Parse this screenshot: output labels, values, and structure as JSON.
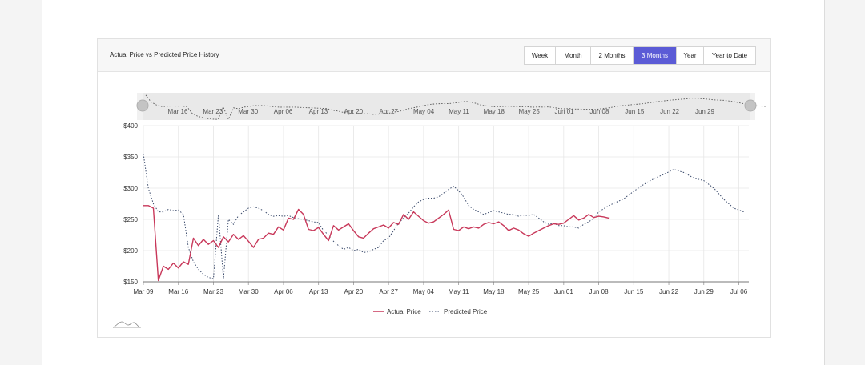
{
  "header": {
    "title": "Actual Price vs Predicted Price History",
    "ranges": [
      "Week",
      "Month",
      "2 Months",
      "3 Months",
      "Year",
      "Year to Date"
    ],
    "active_range": "3 Months"
  },
  "colors": {
    "actual": "#c8385a",
    "predicted": "#3a4a6b",
    "active_button": "#5b5bd6",
    "grid": "#e6e6e6"
  },
  "chart_data": {
    "type": "line",
    "title": "",
    "xlabel": "",
    "ylabel": "",
    "ylim": [
      150,
      400
    ],
    "y_ticks": [
      "$150",
      "$200",
      "$250",
      "$300",
      "$350",
      "$400"
    ],
    "y_tick_values": [
      150,
      200,
      250,
      300,
      350,
      400
    ],
    "x_range": [
      "2020-03-09",
      "2020-07-08"
    ],
    "x_ticks": [
      "Mar 09",
      "Mar 16",
      "Mar 23",
      "Mar 30",
      "Apr 06",
      "Apr 13",
      "Apr 20",
      "Apr 27",
      "May 04",
      "May 11",
      "May 18",
      "May 25",
      "Jun 01",
      "Jun 08",
      "Jun 15",
      "Jun 22",
      "Jun 29",
      "Jul 06"
    ],
    "x_tick_dates": [
      "2020-03-09",
      "2020-03-16",
      "2020-03-23",
      "2020-03-30",
      "2020-04-06",
      "2020-04-13",
      "2020-04-20",
      "2020-04-27",
      "2020-05-04",
      "2020-05-11",
      "2020-05-18",
      "2020-05-25",
      "2020-06-01",
      "2020-06-08",
      "2020-06-15",
      "2020-06-22",
      "2020-06-29",
      "2020-07-06"
    ],
    "navigator_ticks": [
      "Mar 16",
      "Mar 23",
      "Mar 30",
      "Apr 06",
      "Apr 13",
      "Apr 20",
      "Apr 27",
      "May 04",
      "May 11",
      "May 18",
      "May 25",
      "Jun 01",
      "Jun 08",
      "Jun 15",
      "Jun 22",
      "Jun 29"
    ],
    "grid": true,
    "legend_position": "bottom-center",
    "series": [
      {
        "name": "Actual Price",
        "style": "solid",
        "points": [
          [
            "2020-03-09",
            272
          ],
          [
            "2020-03-10",
            272
          ],
          [
            "2020-03-11",
            268
          ],
          [
            "2020-03-12",
            152
          ],
          [
            "2020-03-13",
            175
          ],
          [
            "2020-03-14",
            170
          ],
          [
            "2020-03-15",
            180
          ],
          [
            "2020-03-16",
            172
          ],
          [
            "2020-03-17",
            182
          ],
          [
            "2020-03-18",
            178
          ],
          [
            "2020-03-19",
            220
          ],
          [
            "2020-03-20",
            208
          ],
          [
            "2020-03-21",
            218
          ],
          [
            "2020-03-22",
            210
          ],
          [
            "2020-03-23",
            216
          ],
          [
            "2020-03-24",
            205
          ],
          [
            "2020-03-25",
            222
          ],
          [
            "2020-03-26",
            214
          ],
          [
            "2020-03-27",
            226
          ],
          [
            "2020-03-28",
            218
          ],
          [
            "2020-03-29",
            224
          ],
          [
            "2020-03-30",
            215
          ],
          [
            "2020-03-31",
            205
          ],
          [
            "2020-04-01",
            218
          ],
          [
            "2020-04-02",
            220
          ],
          [
            "2020-04-03",
            228
          ],
          [
            "2020-04-04",
            226
          ],
          [
            "2020-04-05",
            238
          ],
          [
            "2020-04-06",
            233
          ],
          [
            "2020-04-07",
            252
          ],
          [
            "2020-04-08",
            250
          ],
          [
            "2020-04-09",
            266
          ],
          [
            "2020-04-10",
            258
          ],
          [
            "2020-04-11",
            234
          ],
          [
            "2020-04-12",
            232
          ],
          [
            "2020-04-13",
            237
          ],
          [
            "2020-04-14",
            226
          ],
          [
            "2020-04-15",
            216
          ],
          [
            "2020-04-16",
            240
          ],
          [
            "2020-04-17",
            233
          ],
          [
            "2020-04-18",
            238
          ],
          [
            "2020-04-19",
            243
          ],
          [
            "2020-04-20",
            232
          ],
          [
            "2020-04-21",
            222
          ],
          [
            "2020-04-22",
            220
          ],
          [
            "2020-04-23",
            228
          ],
          [
            "2020-04-24",
            235
          ],
          [
            "2020-04-25",
            238
          ],
          [
            "2020-04-26",
            241
          ],
          [
            "2020-04-27",
            236
          ],
          [
            "2020-04-28",
            245
          ],
          [
            "2020-04-29",
            242
          ],
          [
            "2020-04-30",
            258
          ],
          [
            "2020-05-01",
            250
          ],
          [
            "2020-05-02",
            262
          ],
          [
            "2020-05-03",
            255
          ],
          [
            "2020-05-04",
            248
          ],
          [
            "2020-05-05",
            244
          ],
          [
            "2020-05-06",
            246
          ],
          [
            "2020-05-07",
            252
          ],
          [
            "2020-05-08",
            258
          ],
          [
            "2020-05-09",
            265
          ],
          [
            "2020-05-10",
            234
          ],
          [
            "2020-05-11",
            232
          ],
          [
            "2020-05-12",
            238
          ],
          [
            "2020-05-13",
            235
          ],
          [
            "2020-05-14",
            238
          ],
          [
            "2020-05-15",
            236
          ],
          [
            "2020-05-16",
            242
          ],
          [
            "2020-05-17",
            245
          ],
          [
            "2020-05-18",
            243
          ],
          [
            "2020-05-19",
            246
          ],
          [
            "2020-05-20",
            240
          ],
          [
            "2020-05-21",
            232
          ],
          [
            "2020-05-22",
            236
          ],
          [
            "2020-05-23",
            233
          ],
          [
            "2020-05-24",
            227
          ],
          [
            "2020-05-25",
            223
          ],
          [
            "2020-05-26",
            228
          ],
          [
            "2020-05-27",
            232
          ],
          [
            "2020-05-28",
            236
          ],
          [
            "2020-05-29",
            240
          ],
          [
            "2020-05-30",
            243
          ],
          [
            "2020-05-31",
            242
          ],
          [
            "2020-06-01",
            244
          ],
          [
            "2020-06-02",
            250
          ],
          [
            "2020-06-03",
            256
          ],
          [
            "2020-06-04",
            249
          ],
          [
            "2020-06-05",
            252
          ],
          [
            "2020-06-06",
            258
          ],
          [
            "2020-06-07",
            253
          ],
          [
            "2020-06-08",
            255
          ],
          [
            "2020-06-09",
            254
          ],
          [
            "2020-06-10",
            252
          ]
        ]
      },
      {
        "name": "Predicted Price",
        "style": "dotted",
        "points": [
          [
            "2020-03-09",
            355
          ],
          [
            "2020-03-10",
            300
          ],
          [
            "2020-03-11",
            275
          ],
          [
            "2020-03-12",
            262
          ],
          [
            "2020-03-13",
            262
          ],
          [
            "2020-03-14",
            266
          ],
          [
            "2020-03-15",
            264
          ],
          [
            "2020-03-16",
            265
          ],
          [
            "2020-03-17",
            258
          ],
          [
            "2020-03-18",
            205
          ],
          [
            "2020-03-19",
            182
          ],
          [
            "2020-03-20",
            170
          ],
          [
            "2020-03-21",
            162
          ],
          [
            "2020-03-22",
            157
          ],
          [
            "2020-03-23",
            155
          ],
          [
            "2020-03-24",
            258
          ],
          [
            "2020-03-25",
            155
          ],
          [
            "2020-03-26",
            250
          ],
          [
            "2020-03-27",
            242
          ],
          [
            "2020-03-28",
            256
          ],
          [
            "2020-03-29",
            262
          ],
          [
            "2020-03-30",
            268
          ],
          [
            "2020-03-31",
            270
          ],
          [
            "2020-04-01",
            268
          ],
          [
            "2020-04-02",
            264
          ],
          [
            "2020-04-03",
            258
          ],
          [
            "2020-04-04",
            255
          ],
          [
            "2020-04-05",
            256
          ],
          [
            "2020-04-06",
            255
          ],
          [
            "2020-04-07",
            256
          ],
          [
            "2020-04-08",
            253
          ],
          [
            "2020-04-09",
            251
          ],
          [
            "2020-04-10",
            250
          ],
          [
            "2020-04-11",
            248
          ],
          [
            "2020-04-12",
            246
          ],
          [
            "2020-04-13",
            245
          ],
          [
            "2020-04-14",
            232
          ],
          [
            "2020-04-15",
            225
          ],
          [
            "2020-04-16",
            215
          ],
          [
            "2020-04-17",
            208
          ],
          [
            "2020-04-18",
            202
          ],
          [
            "2020-04-19",
            205
          ],
          [
            "2020-04-20",
            200
          ],
          [
            "2020-04-21",
            202
          ],
          [
            "2020-04-22",
            197
          ],
          [
            "2020-04-23",
            198
          ],
          [
            "2020-04-24",
            202
          ],
          [
            "2020-04-25",
            205
          ],
          [
            "2020-04-26",
            216
          ],
          [
            "2020-04-27",
            220
          ],
          [
            "2020-04-28",
            232
          ],
          [
            "2020-04-29",
            244
          ],
          [
            "2020-04-30",
            252
          ],
          [
            "2020-05-01",
            260
          ],
          [
            "2020-05-02",
            270
          ],
          [
            "2020-05-03",
            278
          ],
          [
            "2020-05-04",
            282
          ],
          [
            "2020-05-05",
            284
          ],
          [
            "2020-05-06",
            284
          ],
          [
            "2020-05-07",
            286
          ],
          [
            "2020-05-08",
            292
          ],
          [
            "2020-05-09",
            298
          ],
          [
            "2020-05-10",
            303
          ],
          [
            "2020-05-11",
            296
          ],
          [
            "2020-05-12",
            286
          ],
          [
            "2020-05-13",
            272
          ],
          [
            "2020-05-14",
            266
          ],
          [
            "2020-05-15",
            262
          ],
          [
            "2020-05-16",
            258
          ],
          [
            "2020-05-17",
            261
          ],
          [
            "2020-05-18",
            264
          ],
          [
            "2020-05-19",
            262
          ],
          [
            "2020-05-20",
            260
          ],
          [
            "2020-05-21",
            258
          ],
          [
            "2020-05-22",
            258
          ],
          [
            "2020-05-23",
            255
          ],
          [
            "2020-05-24",
            257
          ],
          [
            "2020-05-25",
            256
          ],
          [
            "2020-05-26",
            258
          ],
          [
            "2020-05-27",
            252
          ],
          [
            "2020-05-28",
            246
          ],
          [
            "2020-05-29",
            242
          ],
          [
            "2020-05-30",
            244
          ],
          [
            "2020-05-31",
            240
          ],
          [
            "2020-06-01",
            240
          ],
          [
            "2020-06-02",
            238
          ],
          [
            "2020-06-03",
            238
          ],
          [
            "2020-06-04",
            236
          ],
          [
            "2020-06-05",
            242
          ],
          [
            "2020-06-06",
            246
          ],
          [
            "2020-06-07",
            252
          ],
          [
            "2020-06-08",
            262
          ],
          [
            "2020-06-10",
            272
          ],
          [
            "2020-06-13",
            283
          ],
          [
            "2020-06-15",
            295
          ],
          [
            "2020-06-17",
            306
          ],
          [
            "2020-06-19",
            315
          ],
          [
            "2020-06-21",
            322
          ],
          [
            "2020-06-23",
            330
          ],
          [
            "2020-06-25",
            325
          ],
          [
            "2020-06-27",
            316
          ],
          [
            "2020-06-29",
            312
          ],
          [
            "2020-07-01",
            300
          ],
          [
            "2020-07-03",
            282
          ],
          [
            "2020-07-05",
            268
          ],
          [
            "2020-07-07",
            262
          ]
        ]
      }
    ]
  }
}
